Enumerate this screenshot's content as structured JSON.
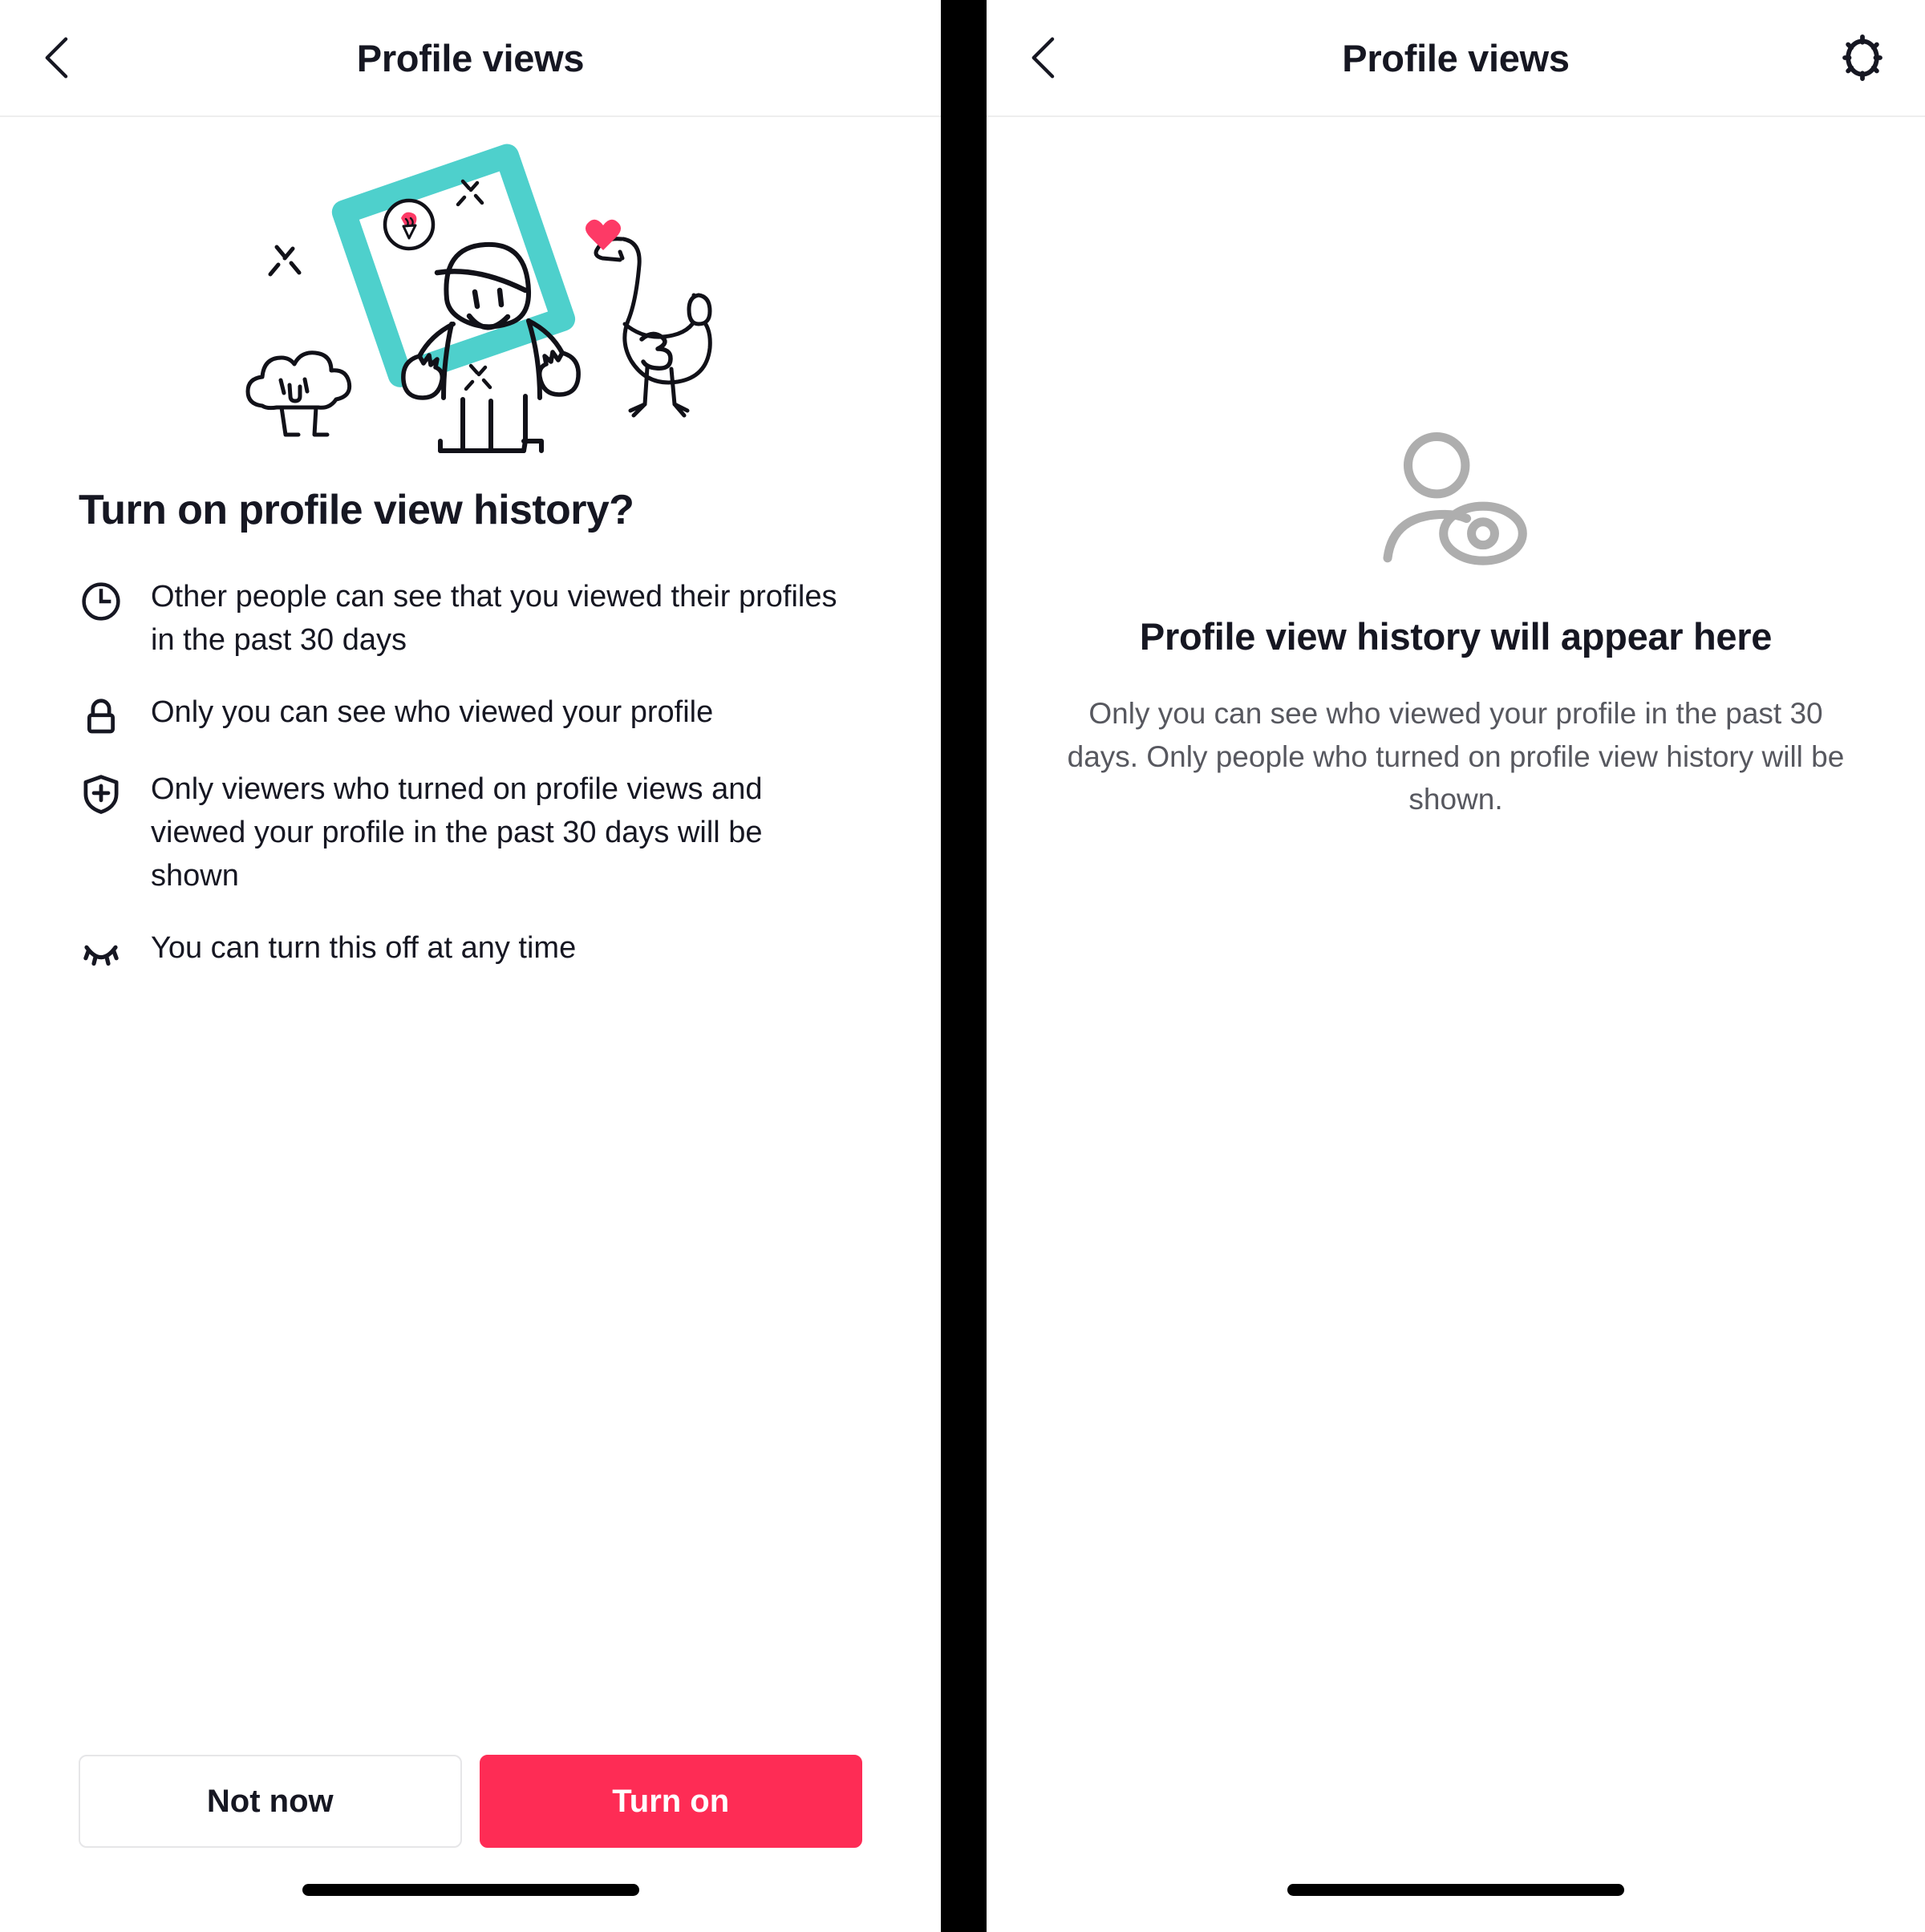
{
  "colors": {
    "accent_red": "#fe2c55",
    "teal_frame": "#4ed0cc",
    "heart_pink": "#fd3a66",
    "text_primary": "#161722",
    "text_secondary": "#57585f",
    "empty_icon_gray": "#aeaeae",
    "divider_black": "#000000"
  },
  "left_screen": {
    "header": {
      "back_icon": "chevron-left-icon",
      "title": "Profile views"
    },
    "illustration": {
      "name": "profile-view-illustration",
      "elements": [
        "teal-photo-frame",
        "smiling-character",
        "cloud-with-face",
        "bird-with-number-3",
        "pink-heart",
        "pink-ice-cream-badge",
        "sparkles"
      ],
      "bird_label": "3"
    },
    "headline": "Turn on profile view history?",
    "bullets": [
      {
        "icon": "clock-icon",
        "text": "Other people can see that you viewed their profiles in the past 30 days"
      },
      {
        "icon": "lock-icon",
        "text": "Only you can see who viewed your profile"
      },
      {
        "icon": "shield-plus-icon",
        "text": "Only viewers who turned on profile views and viewed your profile in the past 30 days will be shown"
      },
      {
        "icon": "eye-closed-icon",
        "text": "You can turn this off at any time"
      }
    ],
    "buttons": {
      "secondary_label": "Not now",
      "primary_label": "Turn on"
    },
    "home_indicator": "home-indicator-bar"
  },
  "right_screen": {
    "header": {
      "back_icon": "chevron-left-icon",
      "title": "Profile views",
      "settings_icon": "gear-icon"
    },
    "empty_state": {
      "icon": "person-with-eye-icon",
      "title": "Profile view history will appear here",
      "description": "Only you can see who viewed your profile in the past 30 days. Only people who turned on profile view history will be shown."
    },
    "home_indicator": "home-indicator-bar"
  }
}
